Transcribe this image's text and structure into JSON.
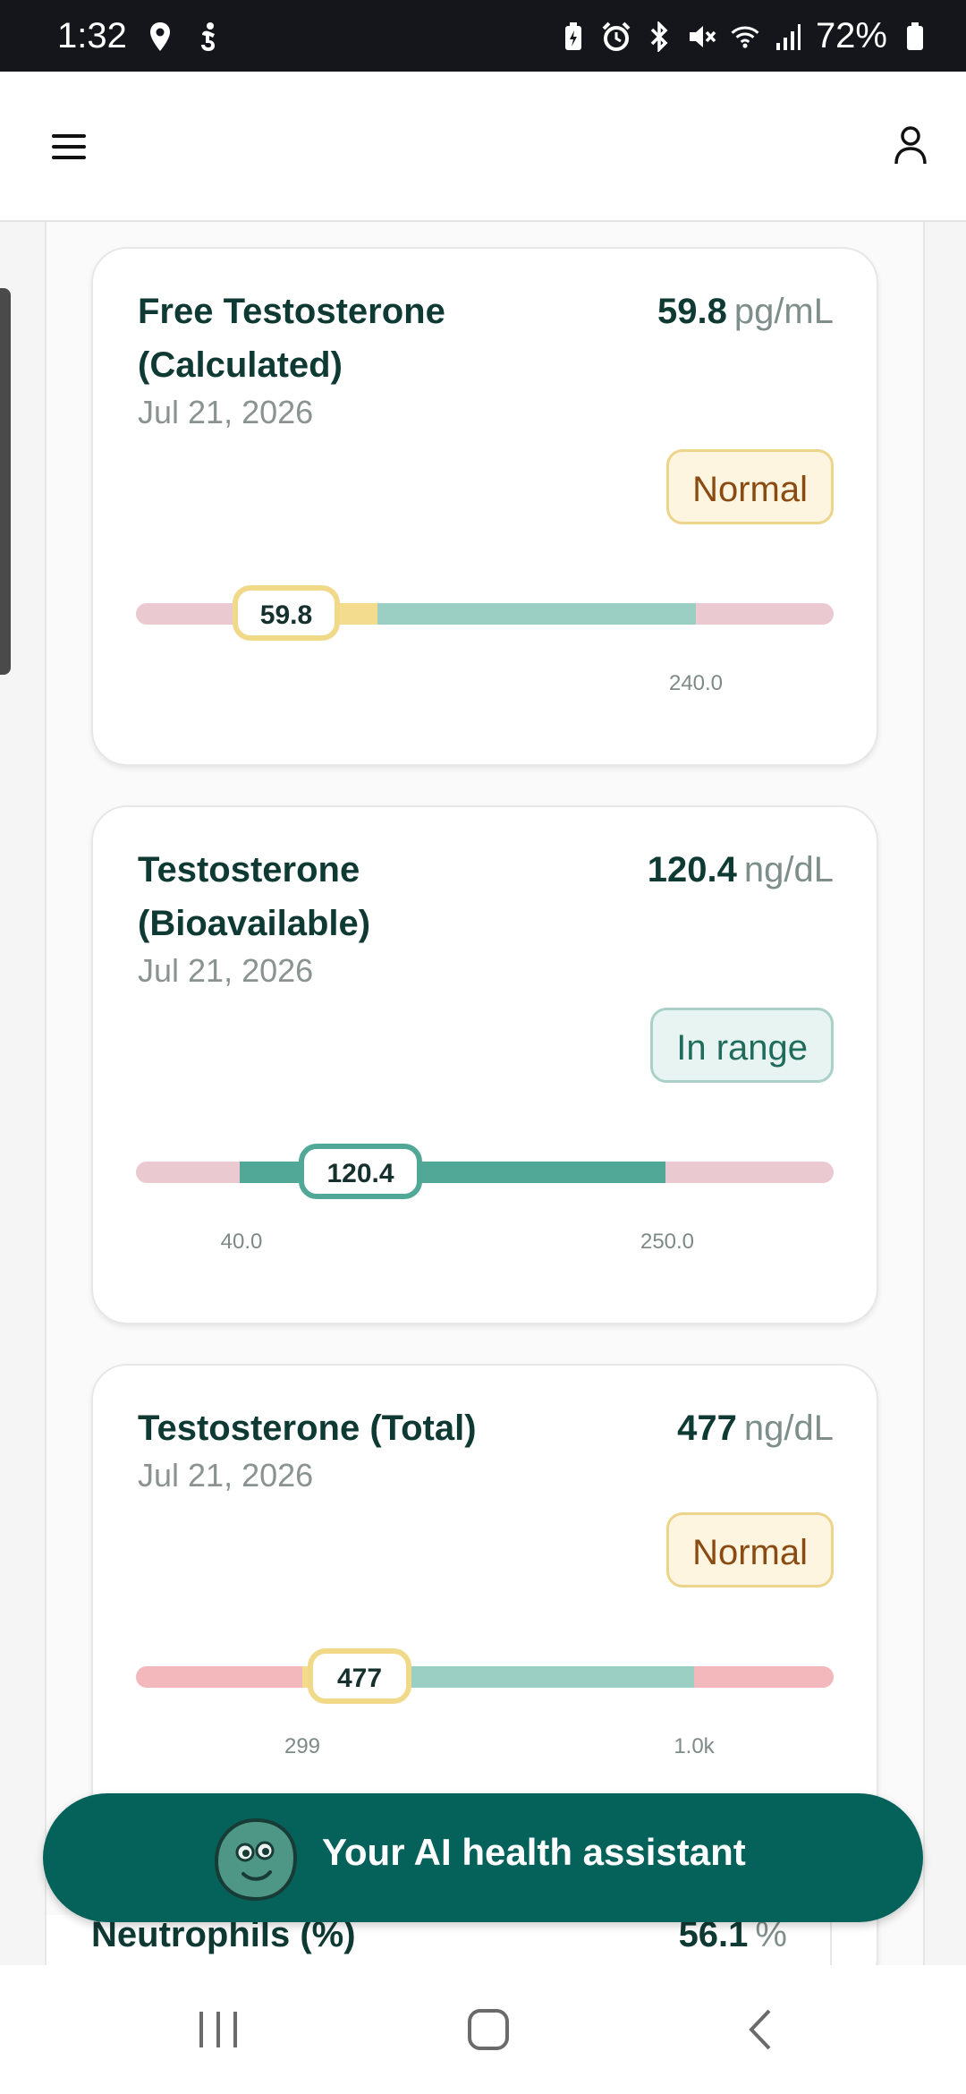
{
  "status_bar": {
    "time": "1:32",
    "battery": "72%",
    "icons_left": [
      "location-icon",
      "accessibility-icon"
    ],
    "icons_right": [
      "battery-saver-icon",
      "alarm-icon",
      "bluetooth-icon",
      "mute-icon",
      "wifi-icon",
      "signal-icon",
      "battery-icon"
    ]
  },
  "app_bar": {
    "menu_icon": "hamburger-menu-icon",
    "profile_icon": "user-icon"
  },
  "cards": [
    {
      "title": "Free Testosterone (Calculated)",
      "date": "Jul 21, 2026",
      "value": "59.8",
      "unit": "pg/mL",
      "status": "Normal",
      "marker_label": "59.8",
      "ticks": [
        "240.0"
      ],
      "status_color": "#ecd58a"
    },
    {
      "title": "Testosterone (Bioavailable)",
      "date": "Jul 21, 2026",
      "value": "120.4",
      "unit": "ng/dL",
      "status": "In range",
      "marker_label": "120.4",
      "ticks": [
        "40.0",
        "250.0"
      ],
      "status_color": "#52a897"
    },
    {
      "title": "Testosterone (Total)",
      "date": "Jul 21, 2026",
      "value": "477",
      "unit": "ng/dL",
      "status": "Normal",
      "marker_label": "477",
      "ticks": [
        "299",
        "1.0k"
      ],
      "status_color": "#ecd58a"
    }
  ],
  "peek_card": {
    "title": "Neutrophils (%)",
    "value": "56.1",
    "unit": "%"
  },
  "assistant_button": {
    "label": "Your AI health assistant",
    "icon": "ai-assistant-avatar-icon"
  },
  "nav_bar": {
    "recents": "recent-apps-icon",
    "home": "home-icon",
    "back": "back-icon"
  },
  "colors": {
    "brand": "#05625a",
    "out_of_range": "#f2c6cc",
    "in_range_light": "#9ccfc4",
    "in_range_dark": "#52a897",
    "borderline": "#f4dc8e"
  }
}
